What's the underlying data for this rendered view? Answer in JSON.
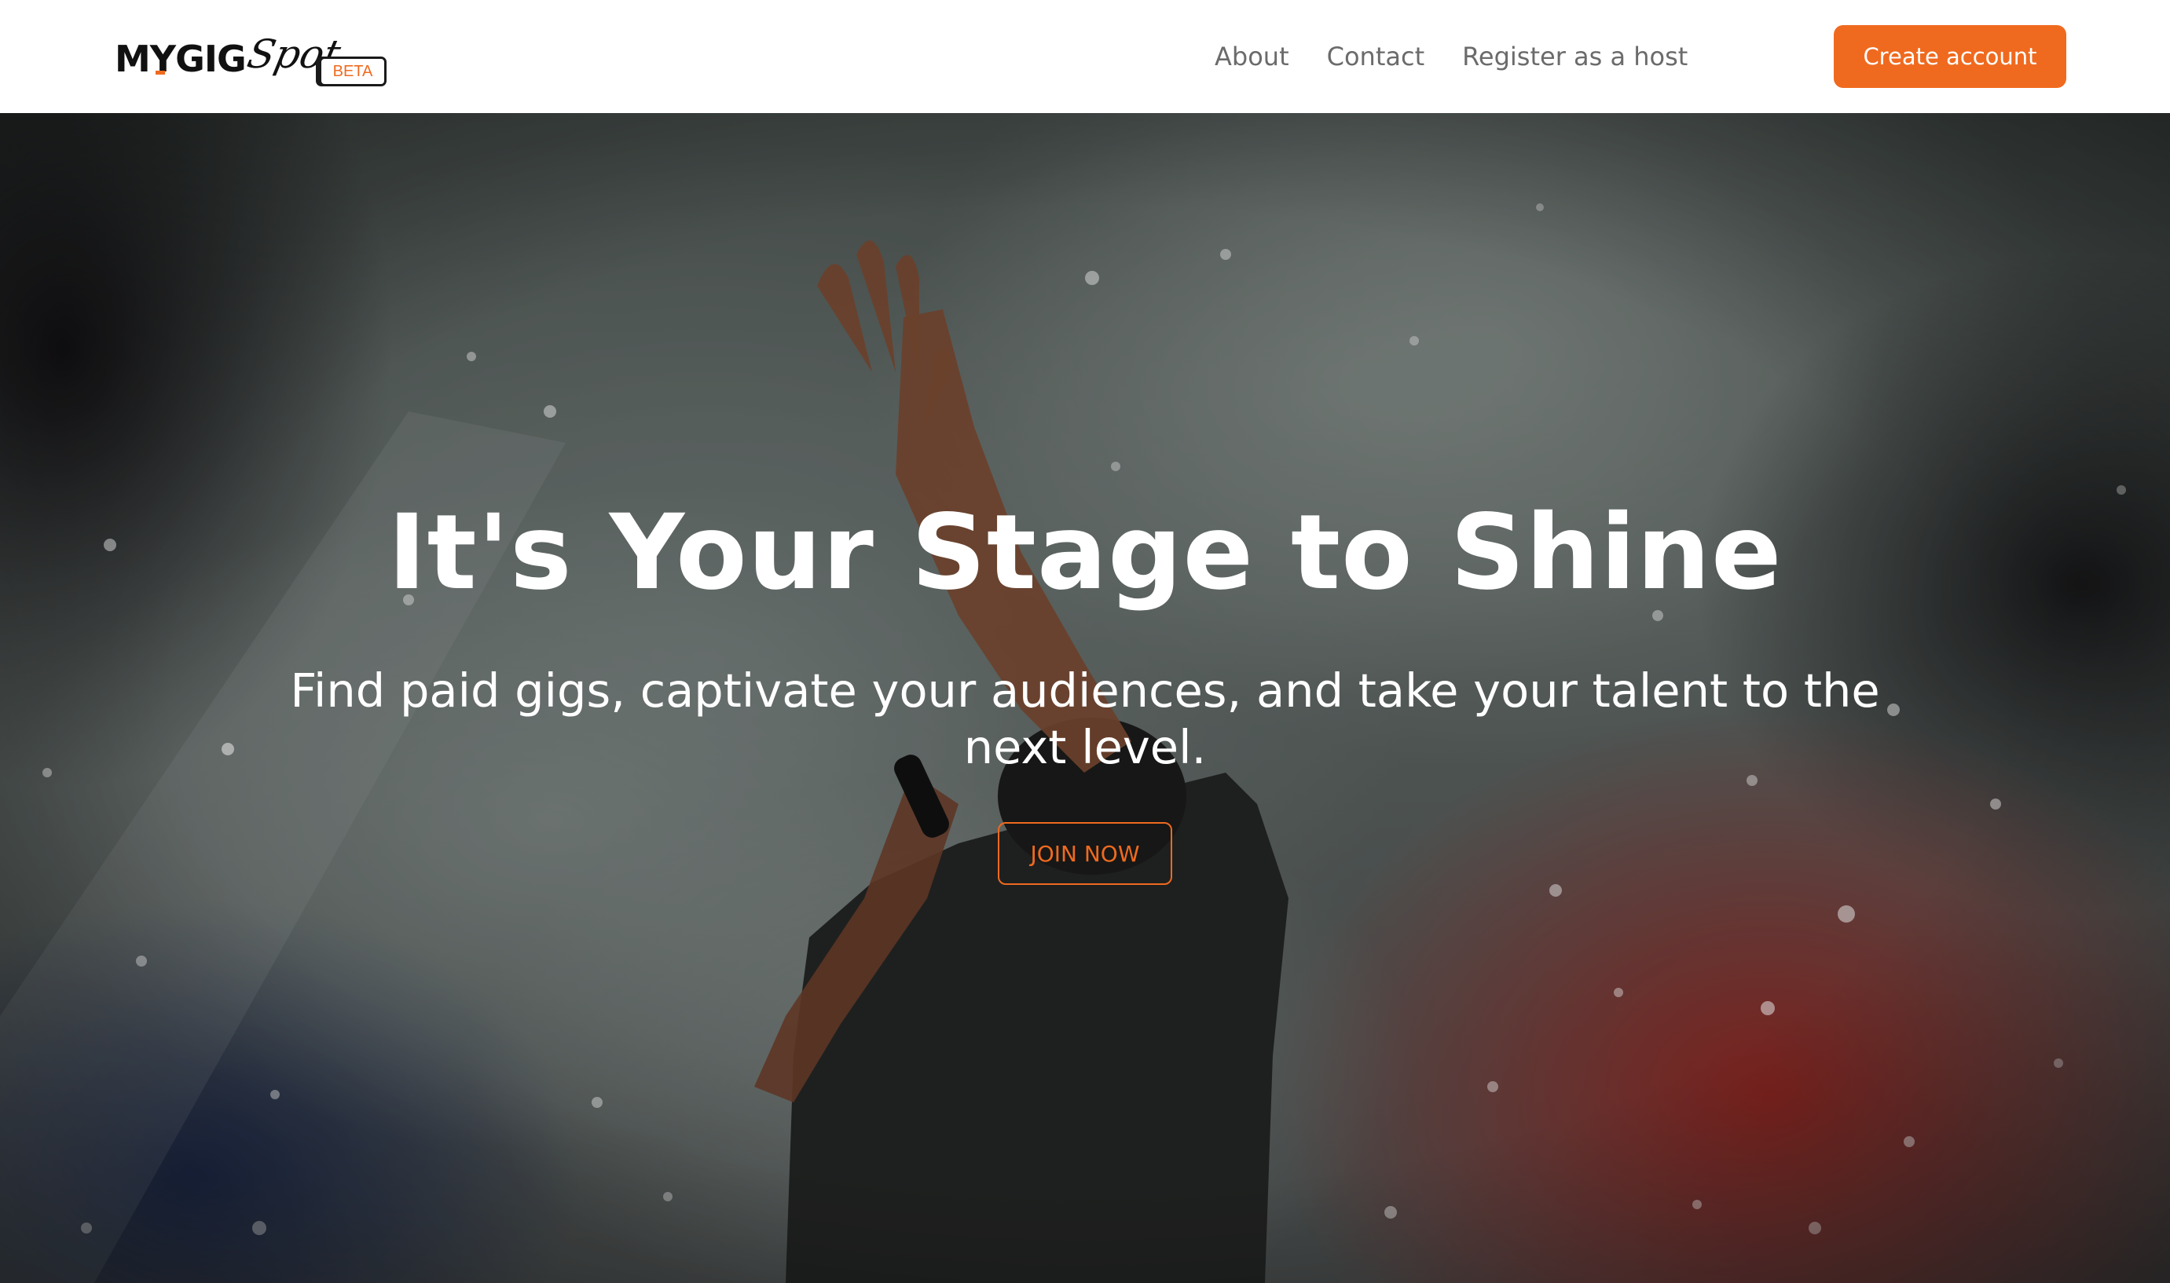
{
  "brand": {
    "name": "MYGIG",
    "script": "Spot",
    "badge": "BETA",
    "accent_color": "#ef6a1f"
  },
  "nav": {
    "links": [
      "About",
      "Contact",
      "Register as a host"
    ],
    "cta_label": "Create account"
  },
  "hero": {
    "title": "It's Your Stage to Shine",
    "subtitle": "Find paid gigs, captivate your audiences, and take your talent to the next level.",
    "button_label": "JOIN NOW",
    "image_subject": "performer-raising-hand-on-stage"
  }
}
